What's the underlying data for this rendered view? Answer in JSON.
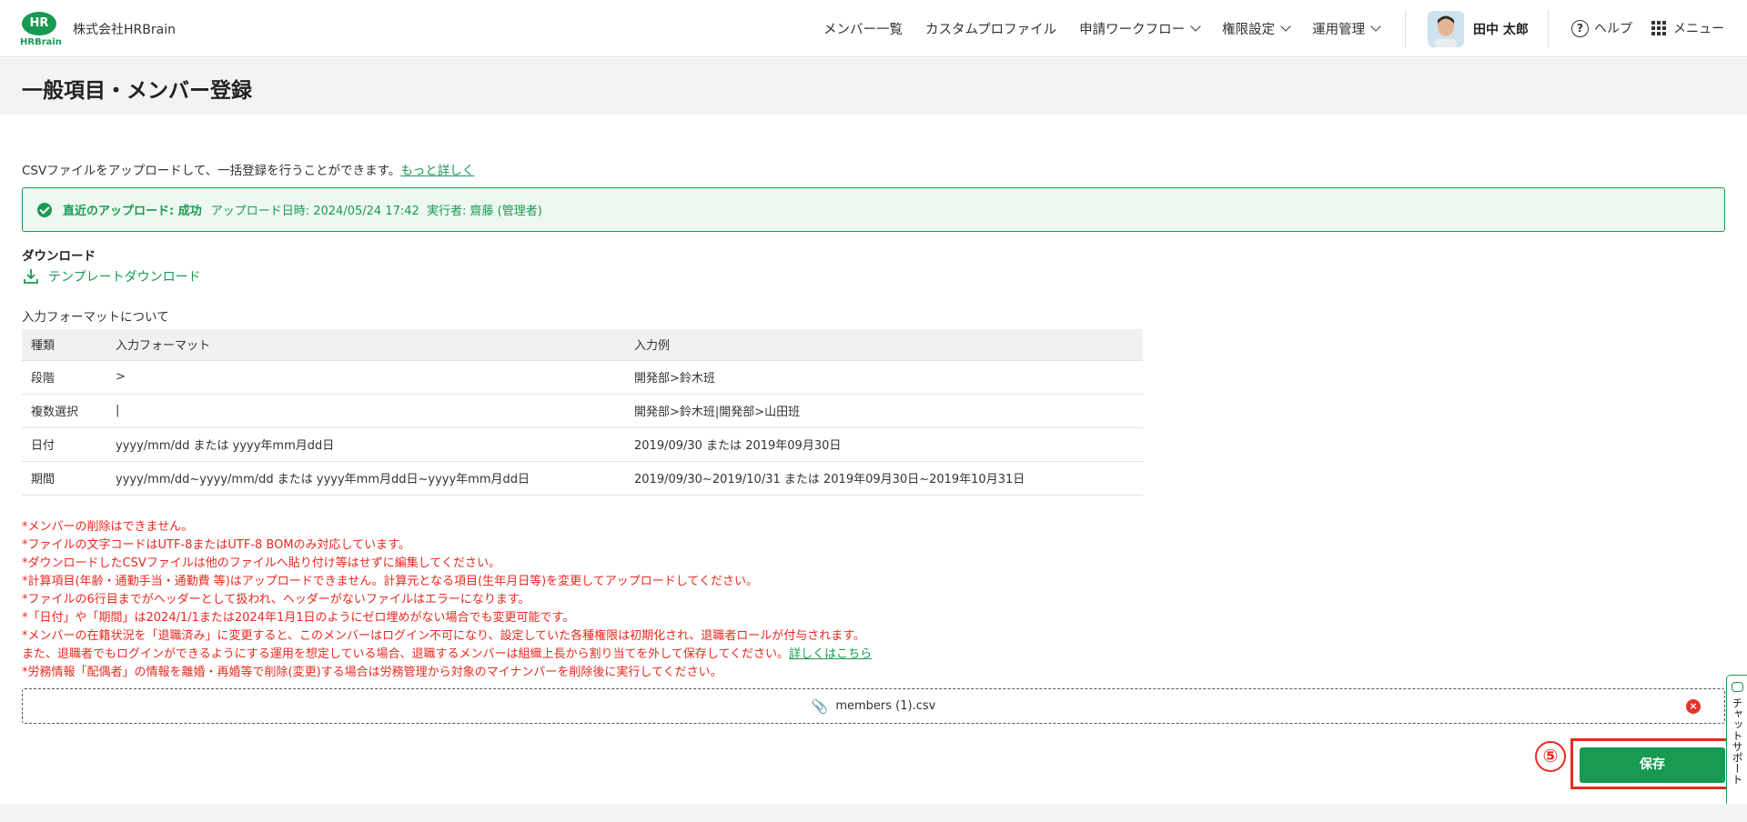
{
  "header": {
    "logo_mark": "HR",
    "logo_text": "HRBrain",
    "company": "株式会社HRBrain",
    "nav": [
      {
        "label": "メンバー一覧",
        "dropdown": false
      },
      {
        "label": "カスタムプロファイル",
        "dropdown": false
      },
      {
        "label": "申請ワークフロー",
        "dropdown": true
      },
      {
        "label": "権限設定",
        "dropdown": true
      },
      {
        "label": "運用管理",
        "dropdown": true
      }
    ],
    "user_name": "田中 太郎",
    "help_label": "ヘルプ",
    "menu_label": "メニュー"
  },
  "page": {
    "title": "一般項目・メンバー登録",
    "intro": "CSVファイルをアップロードして、一括登録を行うことができます。",
    "intro_link": "もっと詳しく"
  },
  "status": {
    "title": "直近のアップロード: 成功",
    "detail": "アップロード日時: 2024/05/24 17:42  実行者: 齋藤 (管理者)"
  },
  "download": {
    "title": "ダウンロード",
    "link": "テンプレートダウンロード"
  },
  "format": {
    "title": "入力フォーマットについて",
    "headers": [
      "種類",
      "入力フォーマット",
      "入力例"
    ],
    "rows": [
      [
        "段階",
        ">",
        "開発部>鈴木班"
      ],
      [
        "複数選択",
        "|",
        "開発部>鈴木班|開発部>山田班"
      ],
      [
        "日付",
        "yyyy/mm/dd または yyyy年mm月dd日",
        "2019/09/30 または 2019年09月30日"
      ],
      [
        "期間",
        "yyyy/mm/dd~yyyy/mm/dd または yyyy年mm月dd日~yyyy年mm月dd日",
        "2019/09/30~2019/10/31 または 2019年09月30日~2019年10月31日"
      ]
    ]
  },
  "notes": [
    "*メンバーの削除はできません。",
    "*ファイルの文字コードはUTF-8またはUTF-8 BOMのみ対応しています。",
    "*ダウンロードしたCSVファイルは他のファイルへ貼り付け等はせずに編集してください。",
    "*計算項目(年齢・通勤手当・通勤費 等)はアップロードできません。計算元となる項目(生年月日等)を変更してアップロードしてください。",
    "*ファイルの6行目までがヘッダーとして扱われ、ヘッダーがないファイルはエラーになります。",
    "*「日付」や「期間」は2024/1/1または2024年1月1日のようにゼロ埋めがない場合でも変更可能です。",
    "*メンバーの在籍状況を「退職済み」に変更すると、このメンバーはログイン不可になり、設定していた各種権限は初期化され、退職者ロールが付与されます。"
  ],
  "note_extra": "また、退職者でもログインができるようにする運用を想定している場合、退職するメンバーは組織上長から割り当てを外して保存してください。",
  "note_extra_link": "詳しくはこちら",
  "note_last": "*労務情報「配偶者」の情報を離婚・再婚等で削除(変更)する場合は労務管理から対象のマイナンバーを削除後に実行してください。",
  "upload": {
    "file_name": "members (1).csv"
  },
  "annotation": {
    "step": "⑤"
  },
  "actions": {
    "save_label": "保存"
  },
  "chat": {
    "label": "チャットサポート"
  },
  "colors": {
    "brand": "#179a52",
    "warning": "#e8291f"
  }
}
